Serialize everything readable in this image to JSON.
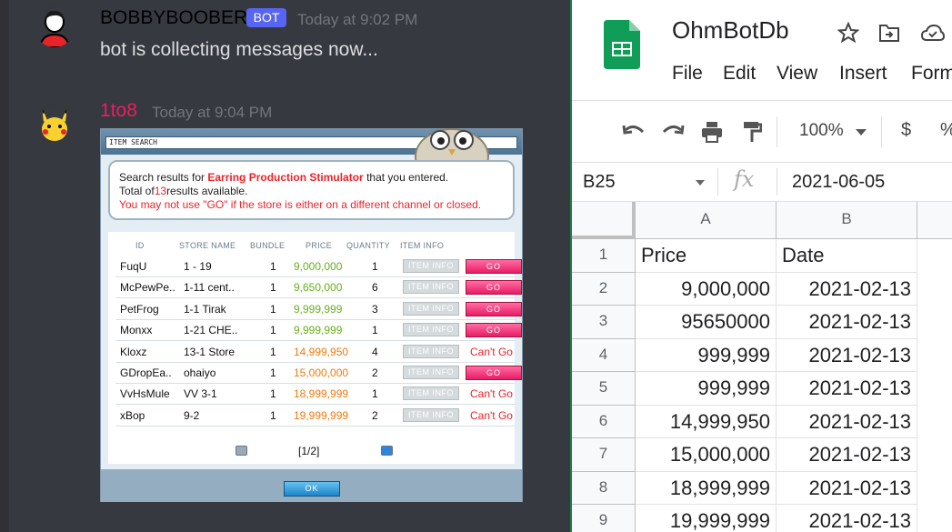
{
  "discord": {
    "messages": [
      {
        "author": "BOBBYBOOBER",
        "badge": "BOT",
        "time": "Today at 9:02 PM",
        "text": "bot is collecting messages now...",
        "author_color": "#ffffff"
      },
      {
        "author": "1to8",
        "time": "Today at 9:04 PM",
        "author_color": "#e91e63"
      }
    ],
    "game": {
      "window_title": "ITEM SEARCH",
      "info": {
        "line1_prefix": "Search results for ",
        "item_name": "Earring Production Stimulator",
        "line1_suffix": " that you entered.",
        "line2_prefix": "Total of",
        "count": "13",
        "line2_suffix": "results available.",
        "warning": "You may not use \"GO\" if the store is either on a different channel or closed."
      },
      "columns": [
        "ID",
        "STORE NAME",
        "BUNDLE",
        "PRICE",
        "QUANTITY",
        "ITEM INFO"
      ],
      "rows": [
        {
          "id": "FuqU",
          "store": "1 - 19",
          "bundle": "1",
          "price": "9,000,000",
          "qty": "1",
          "info": "ITEM INFO",
          "action": "GO",
          "price_color": "green"
        },
        {
          "id": "McPewPe..",
          "store": "1-11 cent..",
          "bundle": "1",
          "price": "9,650,000",
          "qty": "6",
          "info": "ITEM INFO",
          "action": "GO",
          "price_color": "green"
        },
        {
          "id": "PetFrog",
          "store": "1-1 Tirak",
          "bundle": "1",
          "price": "9,999,999",
          "qty": "3",
          "info": "ITEM INFO",
          "action": "GO",
          "price_color": "green"
        },
        {
          "id": "Monxx",
          "store": "1-21 CHE..",
          "bundle": "1",
          "price": "9,999,999",
          "qty": "1",
          "info": "ITEM INFO",
          "action": "GO",
          "price_color": "green"
        },
        {
          "id": "Kloxz",
          "store": "13-1 Store",
          "bundle": "1",
          "price": "14,999,950",
          "qty": "4",
          "info": "ITEM INFO",
          "action": "Can't Go",
          "price_color": "orange"
        },
        {
          "id": "GDropEa..",
          "store": "ohaiyo",
          "bundle": "1",
          "price": "15,000,000",
          "qty": "2",
          "info": "ITEM INFO",
          "action": "GO",
          "price_color": "orange"
        },
        {
          "id": "VvHsMule",
          "store": "VV 3-1",
          "bundle": "1",
          "price": "18,999,999",
          "qty": "1",
          "info": "ITEM INFO",
          "action": "Can't Go",
          "price_color": "orange"
        },
        {
          "id": "xBop",
          "store": "9-2",
          "bundle": "1",
          "price": "19,999,999",
          "qty": "2",
          "info": "ITEM INFO",
          "action": "Can't Go",
          "price_color": "orange"
        }
      ],
      "pager": "[1/2]",
      "ok_label": "OK"
    }
  },
  "sheets": {
    "title": "OhmBotDb",
    "menu": [
      "File",
      "Edit",
      "View",
      "Insert",
      "Form"
    ],
    "zoom": "100%",
    "currency": "$",
    "percent": "%",
    "cell_ref": "B25",
    "formula_value": "2021-06-05",
    "fx": "fx",
    "col_headers": [
      "A",
      "B"
    ],
    "rows": [
      {
        "num": "1",
        "a": "Price",
        "b": "Date"
      },
      {
        "num": "2",
        "a": "9,000,000",
        "b": "2021-02-13"
      },
      {
        "num": "3",
        "a": "95650000",
        "b": "2021-02-13"
      },
      {
        "num": "4",
        "a": "999,999",
        "b": "2021-02-13"
      },
      {
        "num": "5",
        "a": "999,999",
        "b": "2021-02-13"
      },
      {
        "num": "6",
        "a": "14,999,950",
        "b": "2021-02-13"
      },
      {
        "num": "7",
        "a": "15,000,000",
        "b": "2021-02-13"
      },
      {
        "num": "8",
        "a": "18,999,999",
        "b": "2021-02-13"
      },
      {
        "num": "9",
        "a": "19,999,999",
        "b": "2021-02-13"
      }
    ]
  }
}
